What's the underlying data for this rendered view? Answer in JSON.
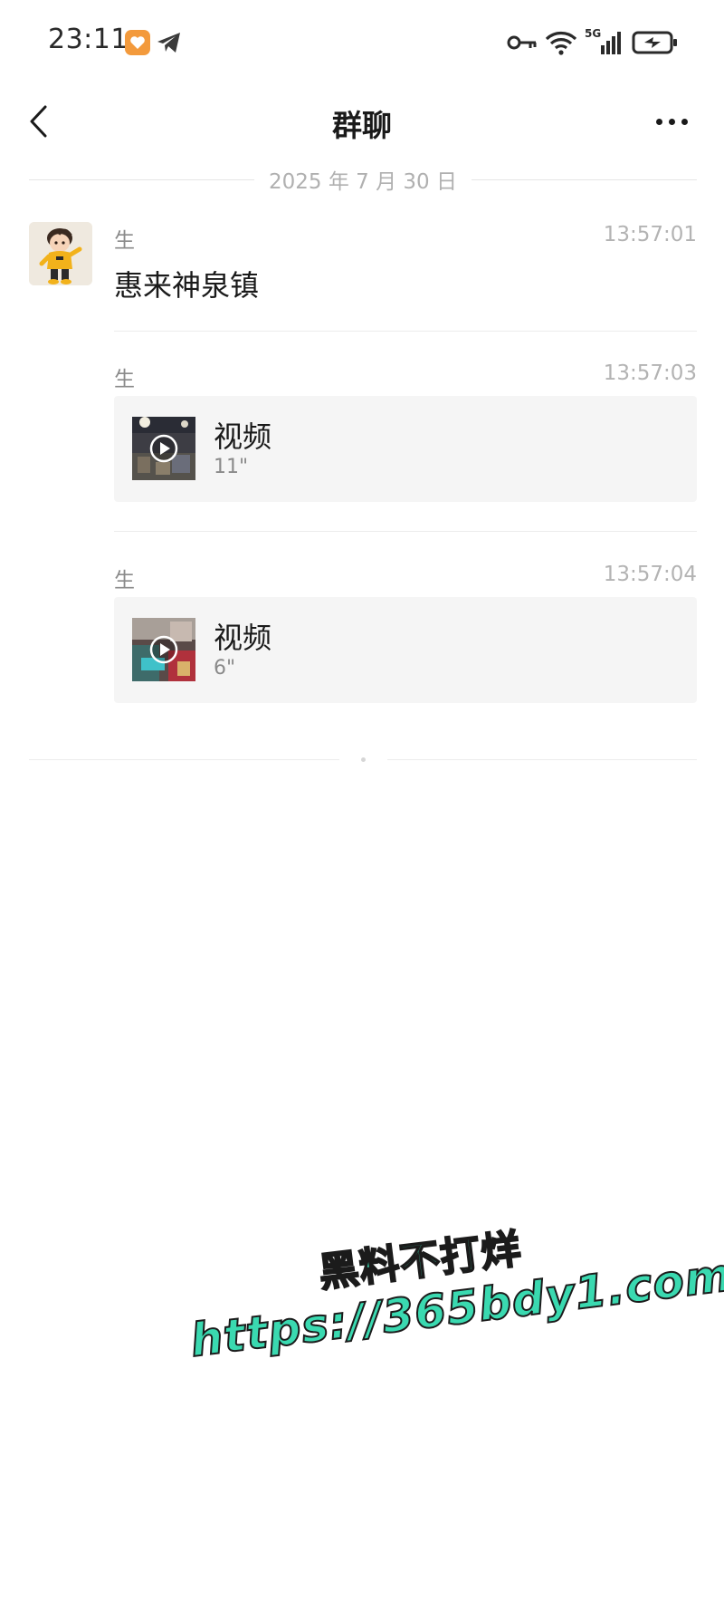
{
  "status_bar": {
    "time": "23:11",
    "app_icon": "orange-heart-app-icon",
    "notification_icon": "telegram-icon",
    "right_icons": [
      "vpn-key-icon",
      "wifi-icon",
      "5g-signal-icon",
      "battery-charging-icon"
    ],
    "network_label": "5G"
  },
  "nav": {
    "title": "群聊",
    "back_icon": "chevron-left-icon",
    "more_icon": "more-horizontal-icon"
  },
  "date_divider": {
    "text": "2025 年 7 月 30 日"
  },
  "messages": [
    {
      "sender": "生",
      "time": "13:57:01",
      "type": "text",
      "text": "惠来神泉镇"
    },
    {
      "sender": "生",
      "time": "13:57:03",
      "type": "video",
      "video_title": "视频",
      "duration": "11\""
    },
    {
      "sender": "生",
      "time": "13:57:04",
      "type": "video",
      "video_title": "视频",
      "duration": "6\""
    }
  ],
  "watermark": {
    "line1": "黑料不打烊",
    "line2": "https://365bdy1.com",
    "color": "#3ad9b0"
  }
}
